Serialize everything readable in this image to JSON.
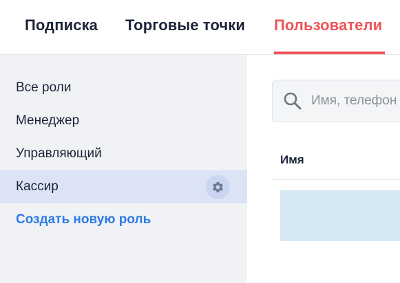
{
  "tabs": [
    {
      "label": "Подписка",
      "active": false
    },
    {
      "label": "Торговые точки",
      "active": false
    },
    {
      "label": "Пользователи",
      "active": true
    }
  ],
  "sidebar": {
    "roles": [
      {
        "label": "Все роли",
        "selected": false
      },
      {
        "label": "Менеджер",
        "selected": false
      },
      {
        "label": "Управляющий",
        "selected": false
      },
      {
        "label": "Кассир",
        "selected": true,
        "settings_icon": "gear-icon"
      }
    ],
    "create_role_label": "Создать новую роль"
  },
  "main": {
    "search": {
      "placeholder": "Имя, телефон",
      "value": "",
      "icon": "search-icon"
    },
    "table": {
      "columns": [
        "Имя"
      ]
    }
  },
  "colors": {
    "accent": "#ef5357",
    "link": "#2d7be7",
    "selected_bg": "#dbe3f5",
    "sidebar_bg": "#f1f2f5"
  }
}
